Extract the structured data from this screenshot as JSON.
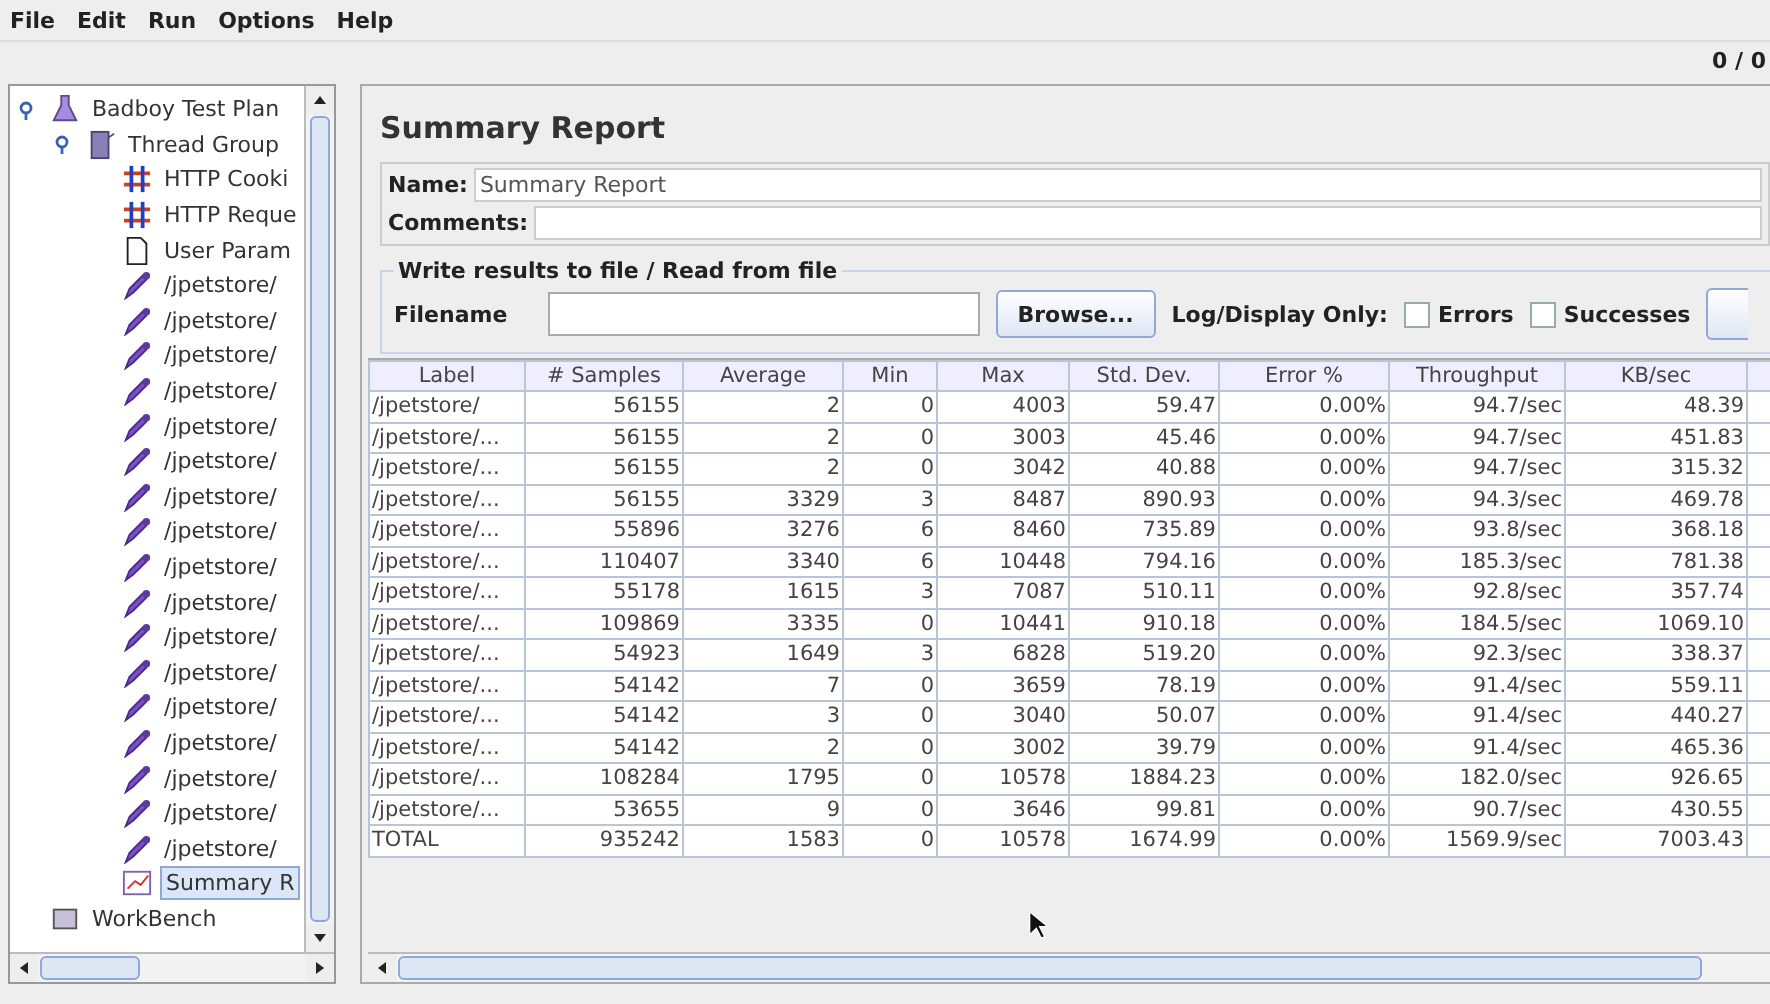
{
  "menu": [
    "File",
    "Edit",
    "Run",
    "Options",
    "Help"
  ],
  "toolbar": {
    "counter": "0 / 0"
  },
  "tree": [
    {
      "label": "Badboy Test Plan",
      "kind": "test-plan",
      "expanded": true,
      "selected": false,
      "children": [
        {
          "label": "Thread Group",
          "kind": "thread-group",
          "expanded": true,
          "selected": false,
          "children": [
            {
              "label": "HTTP Cooki",
              "kind": "config",
              "selected": false
            },
            {
              "label": "HTTP Reque",
              "kind": "config",
              "selected": false
            },
            {
              "label": "User Param",
              "kind": "document",
              "selected": false
            },
            {
              "label": "/jpetstore/",
              "kind": "sampler",
              "selected": false
            },
            {
              "label": "/jpetstore/",
              "kind": "sampler",
              "selected": false
            },
            {
              "label": "/jpetstore/",
              "kind": "sampler",
              "selected": false
            },
            {
              "label": "/jpetstore/",
              "kind": "sampler",
              "selected": false
            },
            {
              "label": "/jpetstore/",
              "kind": "sampler",
              "selected": false
            },
            {
              "label": "/jpetstore/",
              "kind": "sampler",
              "selected": false
            },
            {
              "label": "/jpetstore/",
              "kind": "sampler",
              "selected": false
            },
            {
              "label": "/jpetstore/",
              "kind": "sampler",
              "selected": false
            },
            {
              "label": "/jpetstore/",
              "kind": "sampler",
              "selected": false
            },
            {
              "label": "/jpetstore/",
              "kind": "sampler",
              "selected": false
            },
            {
              "label": "/jpetstore/",
              "kind": "sampler",
              "selected": false
            },
            {
              "label": "/jpetstore/",
              "kind": "sampler",
              "selected": false
            },
            {
              "label": "/jpetstore/",
              "kind": "sampler",
              "selected": false
            },
            {
              "label": "/jpetstore/",
              "kind": "sampler",
              "selected": false
            },
            {
              "label": "/jpetstore/",
              "kind": "sampler",
              "selected": false
            },
            {
              "label": "/jpetstore/",
              "kind": "sampler",
              "selected": false
            },
            {
              "label": "/jpetstore/",
              "kind": "sampler",
              "selected": false
            },
            {
              "label": "Summary R",
              "kind": "listener",
              "selected": true
            }
          ]
        }
      ]
    },
    {
      "label": "WorkBench",
      "kind": "workbench",
      "selected": false
    }
  ],
  "panel": {
    "title": "Summary Report",
    "name_label": "Name:",
    "name_value": "Summary Report",
    "comments_label": "Comments:",
    "file_group": {
      "legend": "Write results to file / Read from file",
      "filename_label": "Filename",
      "browse": "Browse...",
      "log_label": "Log/Display Only:",
      "options": [
        {
          "label": "Errors",
          "checked": false
        },
        {
          "label": "Successes",
          "checked": false
        }
      ]
    }
  },
  "table": {
    "columns": [
      "Label",
      "# Samples",
      "Average",
      "Min",
      "Max",
      "Std. Dev.",
      "Error %",
      "Throughput",
      "KB/sec"
    ],
    "rows": [
      [
        "/jpetstore/",
        "56155",
        "2",
        "0",
        "4003",
        "59.47",
        "0.00%",
        "94.7/sec",
        "48.39"
      ],
      [
        "/jpetstore/...",
        "56155",
        "2",
        "0",
        "3003",
        "45.46",
        "0.00%",
        "94.7/sec",
        "451.83"
      ],
      [
        "/jpetstore/...",
        "56155",
        "2",
        "0",
        "3042",
        "40.88",
        "0.00%",
        "94.7/sec",
        "315.32"
      ],
      [
        "/jpetstore/...",
        "56155",
        "3329",
        "3",
        "8487",
        "890.93",
        "0.00%",
        "94.3/sec",
        "469.78"
      ],
      [
        "/jpetstore/...",
        "55896",
        "3276",
        "6",
        "8460",
        "735.89",
        "0.00%",
        "93.8/sec",
        "368.18"
      ],
      [
        "/jpetstore/...",
        "110407",
        "3340",
        "6",
        "10448",
        "794.16",
        "0.00%",
        "185.3/sec",
        "781.38"
      ],
      [
        "/jpetstore/...",
        "55178",
        "1615",
        "3",
        "7087",
        "510.11",
        "0.00%",
        "92.8/sec",
        "357.74"
      ],
      [
        "/jpetstore/...",
        "109869",
        "3335",
        "0",
        "10441",
        "910.18",
        "0.00%",
        "184.5/sec",
        "1069.10"
      ],
      [
        "/jpetstore/...",
        "54923",
        "1649",
        "3",
        "6828",
        "519.20",
        "0.00%",
        "92.3/sec",
        "338.37"
      ],
      [
        "/jpetstore/...",
        "54142",
        "7",
        "0",
        "3659",
        "78.19",
        "0.00%",
        "91.4/sec",
        "559.11"
      ],
      [
        "/jpetstore/...",
        "54142",
        "3",
        "0",
        "3040",
        "50.07",
        "0.00%",
        "91.4/sec",
        "440.27"
      ],
      [
        "/jpetstore/...",
        "54142",
        "2",
        "0",
        "3002",
        "39.79",
        "0.00%",
        "91.4/sec",
        "465.36"
      ],
      [
        "/jpetstore/...",
        "108284",
        "1795",
        "0",
        "10578",
        "1884.23",
        "0.00%",
        "182.0/sec",
        "926.65"
      ],
      [
        "/jpetstore/...",
        "53655",
        "9",
        "0",
        "3646",
        "99.81",
        "0.00%",
        "90.7/sec",
        "430.55"
      ],
      [
        "TOTAL",
        "935242",
        "1583",
        "0",
        "10578",
        "1674.99",
        "0.00%",
        "1569.9/sec",
        "7003.43"
      ]
    ]
  }
}
